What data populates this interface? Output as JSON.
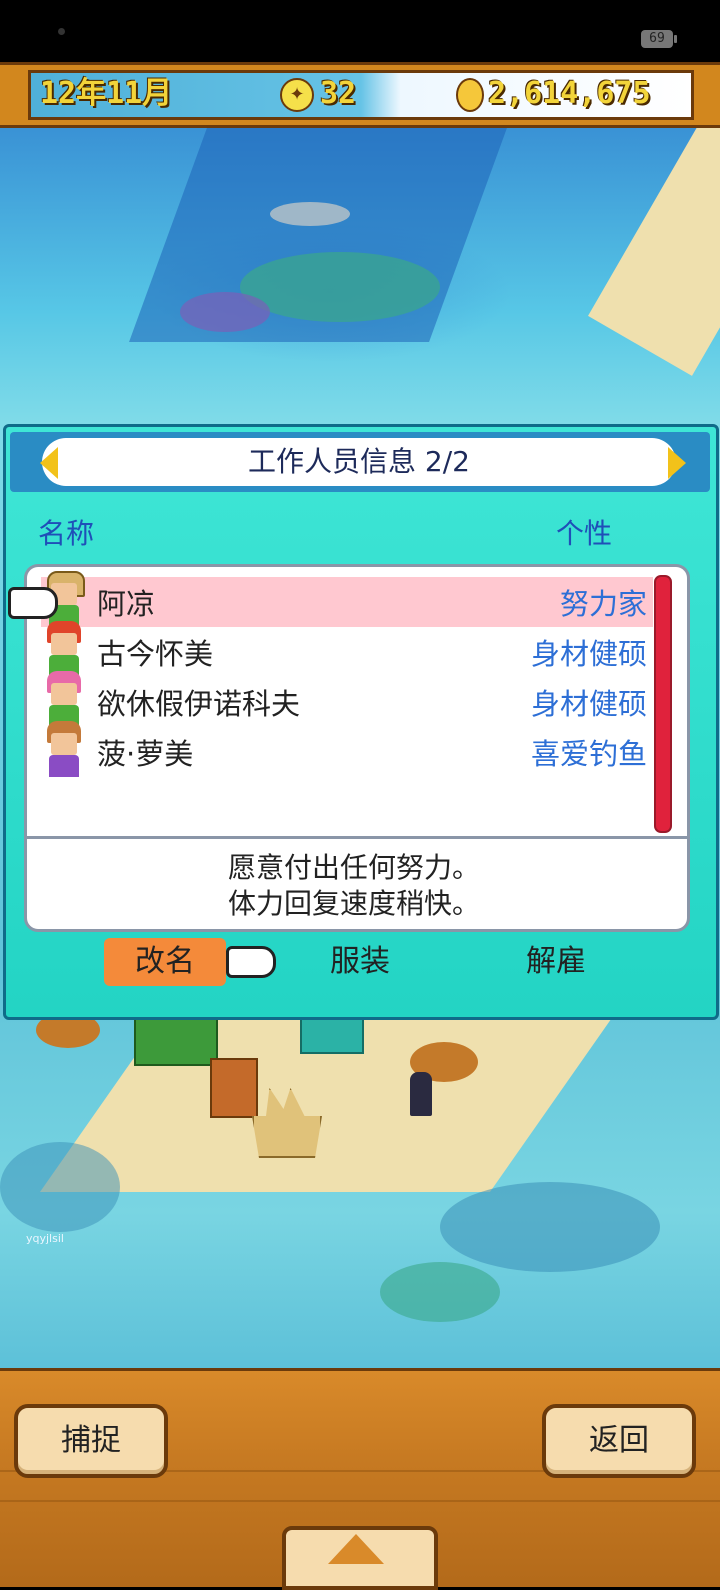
{
  "status_bar": {
    "battery": "69"
  },
  "hud": {
    "date": "12年11月",
    "ideas": "32",
    "money": "2,614,675"
  },
  "dialog": {
    "title": "工作人员信息 2/2",
    "header_name": "名称",
    "header_trait": "个性",
    "staff": [
      {
        "name": "阿凉",
        "trait": "努力家",
        "selected": true
      },
      {
        "name": "古今怀美",
        "trait": "身材健硕",
        "selected": false
      },
      {
        "name": "欲休假伊诺科夫",
        "trait": "身材健硕",
        "selected": false
      },
      {
        "name": "菠·萝美",
        "trait": "喜爱钓鱼",
        "selected": false
      }
    ],
    "description_line1": "愿意付出任何努力。",
    "description_line2": "体力回复速度稍快。",
    "actions": {
      "rename": "改名",
      "outfit": "服装",
      "fire": "解雇"
    }
  },
  "bottom": {
    "capture": "捕捉",
    "back": "返回"
  },
  "watermark": "yqyjlsil",
  "colors": {
    "panel": "#23d4c4",
    "title_bar": "#2a8cc4",
    "selected_row": "#ffc8d0",
    "trait_text": "#2d6fd6",
    "rename_button": "#f48a3a",
    "wood": "#d98a2a"
  },
  "icons": [
    "lightbulb-icon",
    "coin-icon",
    "pointing-hand-icon",
    "arrow-left-icon",
    "arrow-right-icon",
    "up-arrow-icon"
  ]
}
